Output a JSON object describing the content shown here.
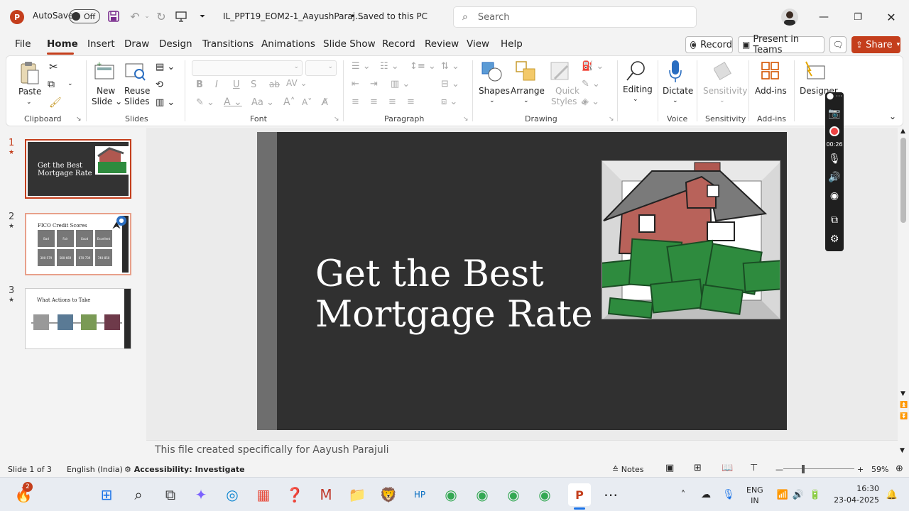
{
  "titlebar": {
    "app_logo": "P",
    "autosave_label": "AutoSave",
    "autosave_state": "Off",
    "filename": "IL_PPT19_EOM2-1_AayushParaj...",
    "save_status": "• Saved to this PC",
    "search_placeholder": "Search"
  },
  "tabs": [
    "File",
    "Home",
    "Insert",
    "Draw",
    "Design",
    "Transitions",
    "Animations",
    "Slide Show",
    "Record",
    "Review",
    "View",
    "Help"
  ],
  "right_buttons": {
    "record": "Record",
    "present": "Present in Teams",
    "share": "Share"
  },
  "ribbon": {
    "paste": "Paste",
    "new_slide": "New",
    "new_slide2": "Slide",
    "reuse": "Reuse",
    "reuse2": "Slides",
    "shapes": "Shapes",
    "arrange": "Arrange",
    "quick": "Quick",
    "quick2": "Styles",
    "editing": "Editing",
    "dictate": "Dictate",
    "sensitivity": "Sensitivity",
    "addins": "Add-ins",
    "designer": "Designer",
    "groups": {
      "clipboard": "Clipboard",
      "slides": "Slides",
      "font": "Font",
      "paragraph": "Paragraph",
      "drawing": "Drawing",
      "voice": "Voice",
      "sensitivity": "Sensitivity",
      "addins": "Add-ins"
    }
  },
  "thumbnails": [
    {
      "num": "1",
      "title": "Get the Best Mortgage Rate"
    },
    {
      "num": "2",
      "title": "FICO Credit Scores",
      "boxes": [
        "Bad",
        "Fair",
        "Good",
        "Excellent"
      ],
      "ranges": [
        "300-579",
        "580-669",
        "670-739",
        "740-850"
      ]
    },
    {
      "num": "3",
      "title": "What Actions to Take"
    }
  ],
  "slide": {
    "title_line1": "Get the Best",
    "title_line2": "Mortgage Rate"
  },
  "notes_text": "This file created specifically for Aayush Parajuli",
  "recording_time": "00:26",
  "status": {
    "slide": "Slide 1 of 3",
    "language": "English (India)",
    "accessibility": "Accessibility: Investigate",
    "notes": "Notes",
    "zoom": "59%"
  },
  "taskbar": {
    "badge": "2",
    "lang1": "ENG",
    "lang2": "IN",
    "time": "16:30",
    "date": "23-04-2025"
  },
  "colors": {
    "accent_red": "#c43e1c",
    "slide_bg": "#303030",
    "share_bg": "#c43e1c"
  }
}
